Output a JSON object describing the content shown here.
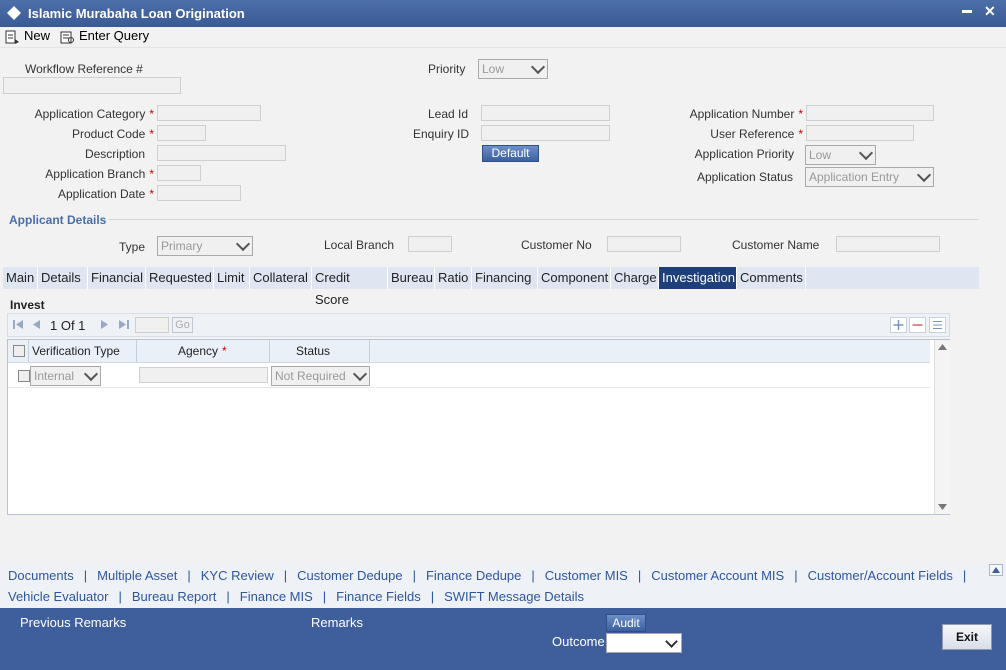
{
  "window": {
    "title": "Islamic Murabaha Loan Origination",
    "minimize": "▬",
    "close": "✕"
  },
  "toolbar": {
    "new_label": "New",
    "enter_query_label": "Enter Query"
  },
  "header": {
    "workflow_ref_label": "Workflow Reference #",
    "priority_label": "Priority",
    "priority_value": "Low",
    "application_category_label": "Application Category",
    "product_code_label": "Product Code",
    "description_label": "Description",
    "application_branch_label": "Application Branch",
    "application_date_label": "Application Date",
    "lead_id_label": "Lead Id",
    "enquiry_id_label": "Enquiry ID",
    "default_button": "Default",
    "application_number_label": "Application Number",
    "user_reference_label": "User Reference",
    "application_priority_label": "Application Priority",
    "application_priority_value": "Low",
    "application_status_label": "Application Status",
    "application_status_value": "Application Entry",
    "required_marker": "*"
  },
  "applicant": {
    "section_title": "Applicant Details",
    "type_label": "Type",
    "type_value": "Primary",
    "local_branch_label": "Local Branch",
    "customer_no_label": "Customer No",
    "customer_name_label": "Customer Name"
  },
  "tabs": [
    "Main",
    "Details",
    "Financial",
    "Requested",
    "Limit",
    "Collateral",
    "Credit Score",
    "Bureau",
    "Ratio",
    "Financing",
    "Component",
    "Charge",
    "Investigation",
    "Comments"
  ],
  "active_tab": "Investigation",
  "invest": {
    "title": "Invest",
    "pager_text": "1 Of 1",
    "go_label": "Go",
    "columns": [
      "Verification Type",
      "Agency",
      "Status"
    ],
    "rows": [
      {
        "verification_type": "Internal",
        "agency": "",
        "status": "Not Required"
      }
    ]
  },
  "links_row1": [
    "Documents",
    "Multiple Asset",
    "KYC Review",
    "Customer Dedupe",
    "Finance Dedupe",
    "Customer MIS",
    "Customer Account MIS",
    "Customer/Account Fields"
  ],
  "links_row2": [
    "Vehicle Evaluator",
    "Bureau Report",
    "Finance MIS",
    "Finance Fields",
    "SWIFT Message Details"
  ],
  "link_separator": "|",
  "footer": {
    "previous_remarks_label": "Previous Remarks",
    "remarks_label": "Remarks",
    "audit_label": "Audit",
    "outcome_label": "Outcome",
    "exit_label": "Exit"
  }
}
